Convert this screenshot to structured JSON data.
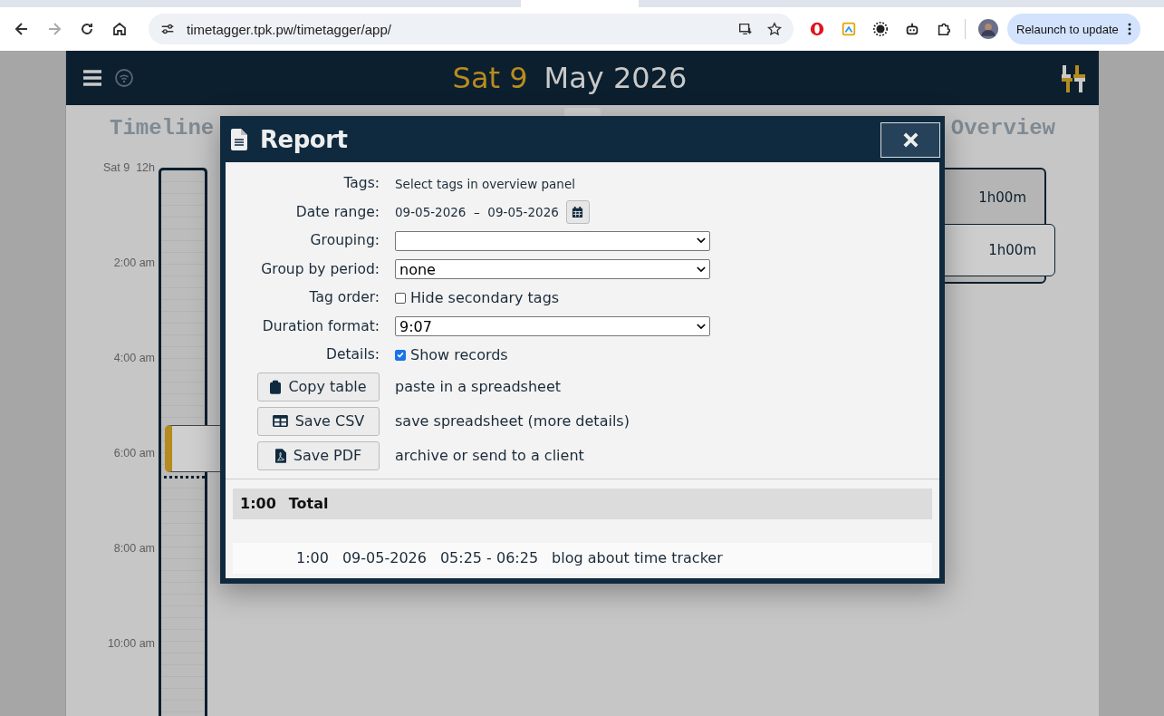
{
  "browser": {
    "url": "timetagger.tpk.pw/timetagger/app/",
    "relaunch_label": "Relaunch to update"
  },
  "header": {
    "day": "Sat 9",
    "month_year": "May 2026"
  },
  "timeline": {
    "title": "Timeline",
    "ticks": [
      "Sat 9  12h",
      "2:00 am",
      "4:00 am",
      "6:00 am",
      "8:00 am",
      "10:00 am"
    ]
  },
  "overview": {
    "title": "Overview",
    "items": [
      {
        "duration": "1h00m"
      },
      {
        "duration": "1h00m"
      }
    ]
  },
  "dialog": {
    "title": "Report",
    "fields": [
      {
        "kind": "text",
        "label": "Tags:",
        "value": "Select tags in overview panel"
      },
      {
        "kind": "daterange",
        "label": "Date range:",
        "value": "09-05-2026  –  09-05-2026"
      },
      {
        "kind": "select",
        "label": "Grouping:"
      },
      {
        "kind": "select",
        "label": "Group by period:",
        "value": "none"
      },
      {
        "kind": "checkbox",
        "label": "Tag order:",
        "option": "Hide secondary tags",
        "checked": false
      },
      {
        "kind": "select",
        "label": "Duration format:",
        "value": "9:07"
      },
      {
        "kind": "checkbox",
        "label": "Details:",
        "option": "Show records",
        "checked": true
      }
    ],
    "actions": [
      {
        "label": "Copy table",
        "description": "paste in a spreadsheet"
      },
      {
        "label": "Save CSV",
        "description": "save spreadsheet (more details)"
      },
      {
        "label": "Save PDF",
        "description": "archive or send to a client"
      }
    ],
    "total": {
      "duration": "1:00",
      "label": "Total"
    },
    "records": [
      {
        "duration": "1:00",
        "date": "09-05-2026",
        "time": "05:25 - 06:25",
        "description": "blog about time tracker"
      }
    ]
  }
}
